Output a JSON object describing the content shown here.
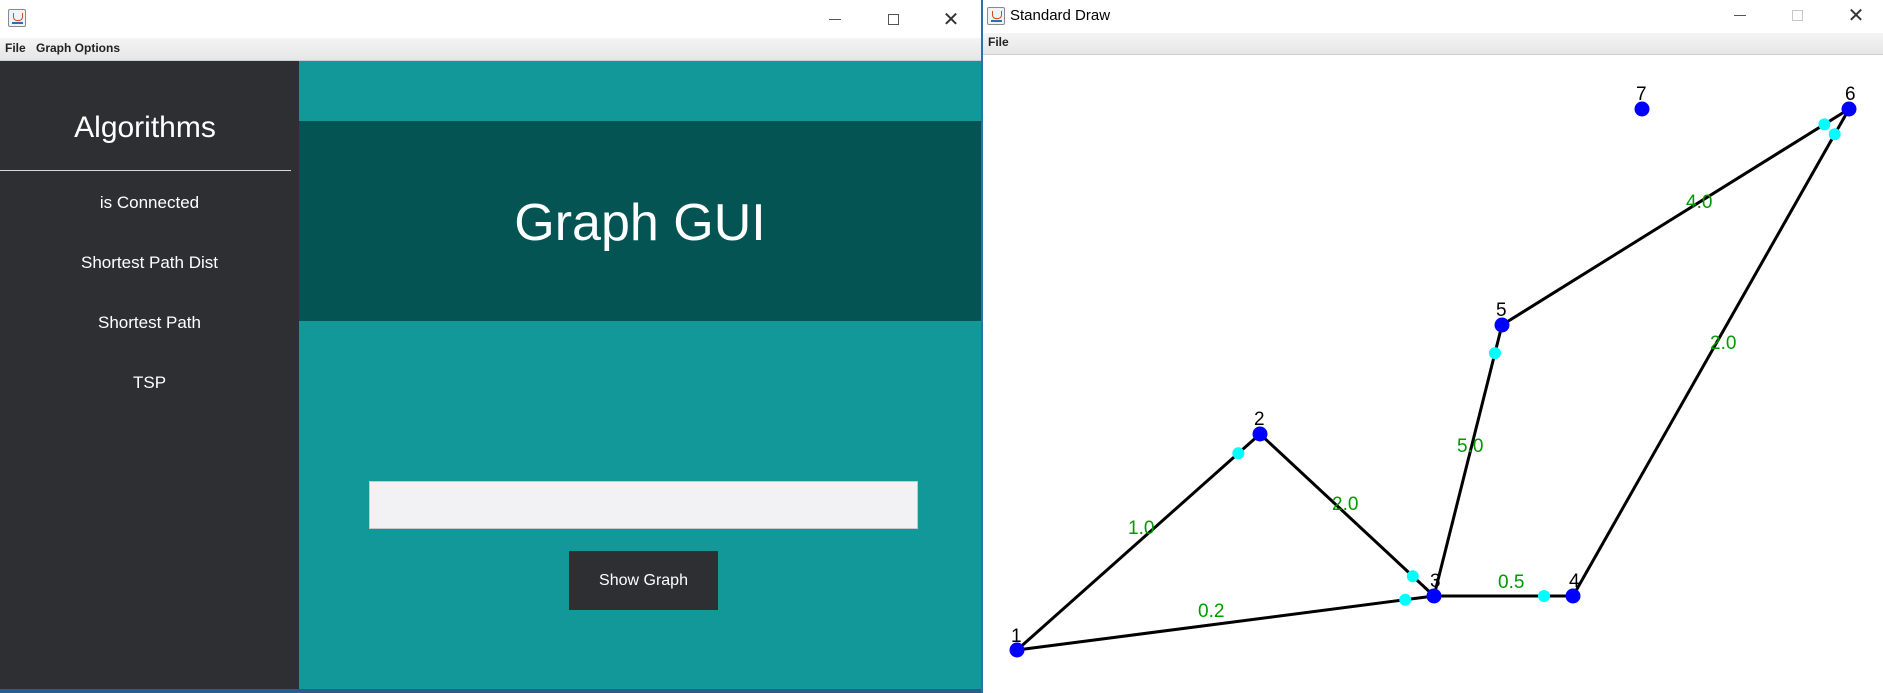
{
  "left_window": {
    "menu": [
      "File",
      "Graph Options"
    ],
    "sidebar": {
      "title": "Algorithms",
      "items": [
        "is Connected",
        "Shortest Path Dist",
        "Shortest Path",
        "TSP"
      ]
    },
    "banner_title": "Graph GUI",
    "input": {
      "value": "",
      "placeholder": ""
    },
    "show_button": "Show Graph"
  },
  "right_window": {
    "title": "Standard Draw",
    "menu": [
      "File"
    ],
    "colors": {
      "node": "#0000ff",
      "arrow_dot": "#00ffff",
      "edge": "#000000",
      "weight": "#009900"
    },
    "nodes": [
      {
        "id": "1"
      },
      {
        "id": "2"
      },
      {
        "id": "3"
      },
      {
        "id": "4"
      },
      {
        "id": "5"
      },
      {
        "id": "6"
      },
      {
        "id": "7"
      }
    ],
    "edges": [
      {
        "from": "1",
        "to": "2",
        "weight": "1.0"
      },
      {
        "from": "1",
        "to": "3",
        "weight": "0.2"
      },
      {
        "from": "2",
        "to": "3",
        "weight": "2.0"
      },
      {
        "from": "3",
        "to": "4",
        "weight": "0.5"
      },
      {
        "from": "3",
        "to": "5",
        "weight": "5.0"
      },
      {
        "from": "5",
        "to": "6",
        "weight": "4.0"
      },
      {
        "from": "4",
        "to": "6",
        "weight": "2.0"
      }
    ]
  }
}
